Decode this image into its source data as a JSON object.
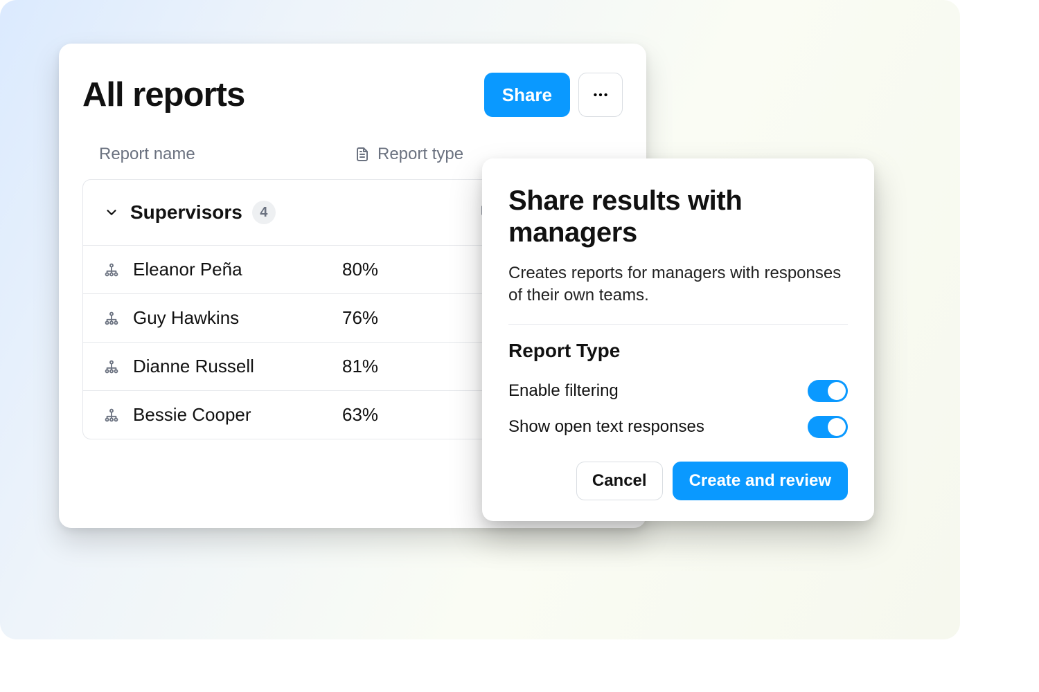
{
  "reports": {
    "title": "All reports",
    "share_label": "Share",
    "columns": {
      "name": "Report name",
      "type": "Report type"
    },
    "group": {
      "name": "Supervisors",
      "count": "4",
      "type_label": "Responses"
    },
    "rows": [
      {
        "name": "Eleanor Peña",
        "value": "80%"
      },
      {
        "name": "Guy Hawkins",
        "value": "76%"
      },
      {
        "name": "Dianne Russell",
        "value": "81%"
      },
      {
        "name": "Bessie Cooper",
        "value": "63%"
      }
    ]
  },
  "dialog": {
    "title": "Share results with managers",
    "description": "Creates reports for managers with responses of their own teams.",
    "section_title": "Report Type",
    "options": {
      "filtering": "Enable filtering",
      "open_text": "Show open text responses"
    },
    "cancel_label": "Cancel",
    "submit_label": "Create and review"
  }
}
